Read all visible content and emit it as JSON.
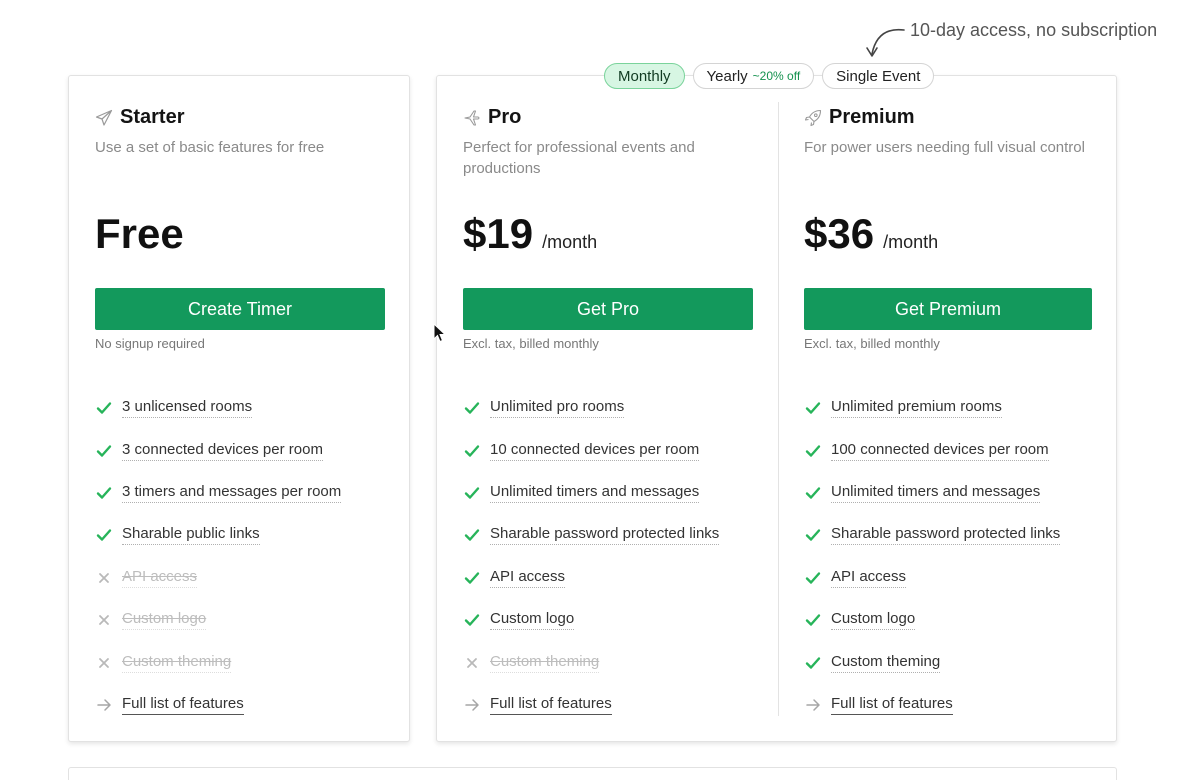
{
  "annotation": "10-day access, no subscription",
  "billing_toggle": {
    "options": [
      {
        "label": "Monthly",
        "badge": "",
        "active": true
      },
      {
        "label": "Yearly",
        "badge": "~20% off",
        "active": false
      },
      {
        "label": "Single Event",
        "badge": "",
        "active": false
      }
    ]
  },
  "colors": {
    "accent": "#13995c",
    "check": "#27b45a",
    "toggle_active": "#d7f6e3"
  },
  "plans": [
    {
      "icon": "paper-plane-icon",
      "name": "Starter",
      "description": "Use a set of basic features for free",
      "price": "Free",
      "period": "",
      "cta": "Create Timer",
      "cta_note": "No signup required",
      "features": [
        {
          "text": "3 unlicensed rooms",
          "status": "included"
        },
        {
          "text": "3 connected devices per room",
          "status": "included"
        },
        {
          "text": "3 timers and messages per room",
          "status": "included"
        },
        {
          "text": "Sharable public links",
          "status": "included"
        },
        {
          "text": "API access",
          "status": "excluded"
        },
        {
          "text": "Custom logo",
          "status": "excluded"
        },
        {
          "text": "Custom theming",
          "status": "excluded"
        },
        {
          "text": "Full list of features",
          "status": "link"
        }
      ]
    },
    {
      "icon": "airplane-icon",
      "name": "Pro",
      "description": "Perfect for professional events and productions",
      "price": "$19",
      "period": "/month",
      "cta": "Get Pro",
      "cta_note": "Excl. tax, billed monthly",
      "features": [
        {
          "text": "Unlimited pro rooms",
          "status": "included"
        },
        {
          "text": "10 connected devices per room",
          "status": "included"
        },
        {
          "text": "Unlimited timers and messages",
          "status": "included"
        },
        {
          "text": "Sharable password protected links",
          "status": "included"
        },
        {
          "text": "API access",
          "status": "included"
        },
        {
          "text": "Custom logo",
          "status": "included"
        },
        {
          "text": "Custom theming",
          "status": "excluded"
        },
        {
          "text": "Full list of features",
          "status": "link"
        }
      ]
    },
    {
      "icon": "rocket-icon",
      "name": "Premium",
      "description": "For power users needing full visual control",
      "price": "$36",
      "period": "/month",
      "cta": "Get Premium",
      "cta_note": "Excl. tax, billed monthly",
      "features": [
        {
          "text": "Unlimited premium rooms",
          "status": "included"
        },
        {
          "text": "100 connected devices per room",
          "status": "included"
        },
        {
          "text": "Unlimited timers and messages",
          "status": "included"
        },
        {
          "text": "Sharable password protected links",
          "status": "included"
        },
        {
          "text": "API access",
          "status": "included"
        },
        {
          "text": "Custom logo",
          "status": "included"
        },
        {
          "text": "Custom theming",
          "status": "included"
        },
        {
          "text": "Full list of features",
          "status": "link"
        }
      ]
    }
  ]
}
